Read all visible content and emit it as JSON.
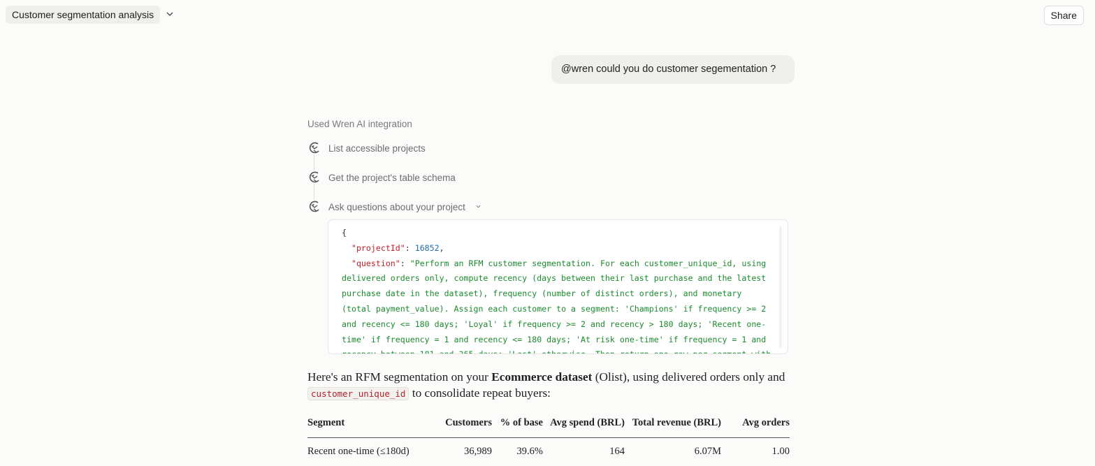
{
  "header": {
    "title": "Customer segmentation analysis",
    "share_label": "Share"
  },
  "user_message": "@wren could you do customer segementation ?",
  "integration": {
    "used_label": "Used Wren AI integration",
    "steps": [
      {
        "label": "List accessible projects"
      },
      {
        "label": "Get the project's table schema"
      },
      {
        "label": "Ask questions about your project"
      }
    ]
  },
  "code": {
    "open_brace": "{",
    "project_key": "\"projectId\"",
    "project_value": "16852",
    "question_key": "\"question\"",
    "question_value": "\"Perform an RFM customer segmentation. For each customer_unique_id, using delivered orders only, compute recency (days between their last purchase and the latest purchase date in the dataset), frequency (number of distinct orders), and monetary (total payment_value). Assign each customer to a segment: 'Champions' if frequency >= 2 and recency <= 180 days; 'Loyal' if frequency >= 2 and recency > 180 days; 'Recent one-time' if frequency = 1 and recency <= 180 days; 'At risk one-time' if frequency = 1 and recency between 181 and 365 days; 'Lost' otherwise. Then return one row per segment with the"
  },
  "response": {
    "intro_a": "Here's an RFM segmentation on your ",
    "dataset_name": "Ecommerce dataset",
    "intro_b": " (Olist), using delivered orders only and ",
    "id_code": "customer_unique_id",
    "intro_c": " to consolidate repeat buyers:"
  },
  "table": {
    "headers": [
      "Segment",
      "Customers",
      "% of base",
      "Avg spend (BRL)",
      "Total revenue (BRL)",
      "Avg orders"
    ],
    "rows": [
      [
        "Recent one-time (≤180d)",
        "36,989",
        "39.6%",
        "164",
        "6.07M",
        "1.00"
      ]
    ]
  },
  "colors": {
    "json_key": "#c0202a",
    "json_number": "#1f6fb0",
    "json_string": "#1b8a2e"
  },
  "icons": {
    "tool": "wren-bird-icon",
    "dropdown": "chevron-down-icon"
  }
}
